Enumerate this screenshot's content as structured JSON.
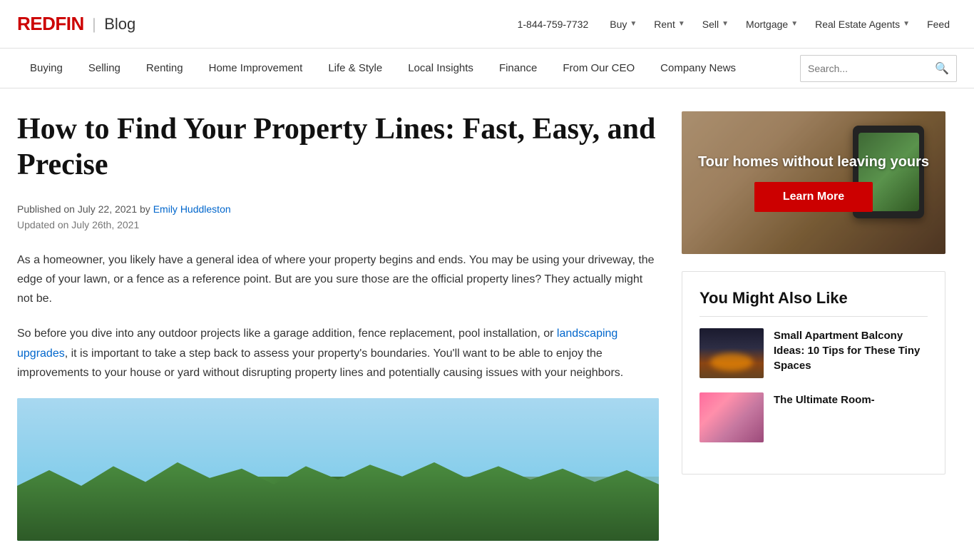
{
  "logo": {
    "redfin": "REDFIN",
    "divider": "|",
    "blog": "Blog"
  },
  "top_nav": {
    "phone": "1-844-759-7732",
    "items": [
      {
        "label": "Buy",
        "has_dropdown": true
      },
      {
        "label": "Rent",
        "has_dropdown": true
      },
      {
        "label": "Sell",
        "has_dropdown": true
      },
      {
        "label": "Mortgage",
        "has_dropdown": true
      },
      {
        "label": "Real Estate Agents",
        "has_dropdown": true
      },
      {
        "label": "Feed",
        "has_dropdown": false
      }
    ]
  },
  "secondary_nav": {
    "items": [
      {
        "label": "Buying"
      },
      {
        "label": "Selling"
      },
      {
        "label": "Renting"
      },
      {
        "label": "Home Improvement"
      },
      {
        "label": "Life & Style"
      },
      {
        "label": "Local Insights"
      },
      {
        "label": "Finance"
      },
      {
        "label": "From Our CEO"
      },
      {
        "label": "Company News"
      }
    ],
    "search_placeholder": "Search..."
  },
  "article": {
    "title": "How to Find Your Property Lines: Fast, Easy, and Precise",
    "published": "Published on July 22, 2021 by ",
    "author": "Emily Huddleston",
    "updated": "Updated on July 26th, 2021",
    "body_p1": "As a homeowner, you likely have a general idea of where your property begins and ends. You may be using your driveway, the edge of your lawn, or a fence as a reference point. But are you sure those are the official property lines? They actually might not be.",
    "body_p2_start": "So before you dive into any outdoor projects like a garage addition, fence replacement, pool installation, or ",
    "body_p2_link": "landscaping upgrades",
    "body_p2_end": ", it is important to take a step back to assess your property's boundaries. You'll want to be able to enjoy the improvements to your house or yard without disrupting property lines and potentially causing issues with your neighbors."
  },
  "sidebar": {
    "ad_banner": {
      "text": "Tour homes without leaving yours",
      "button_label": "Learn More"
    },
    "also_like": {
      "title": "You Might Also Like",
      "items": [
        {
          "title": "Small Apartment Balcony Ideas: 10 Tips for These Tiny Spaces",
          "thumb_type": "balcony"
        },
        {
          "title": "The Ultimate Room-",
          "thumb_type": "room"
        }
      ]
    }
  }
}
